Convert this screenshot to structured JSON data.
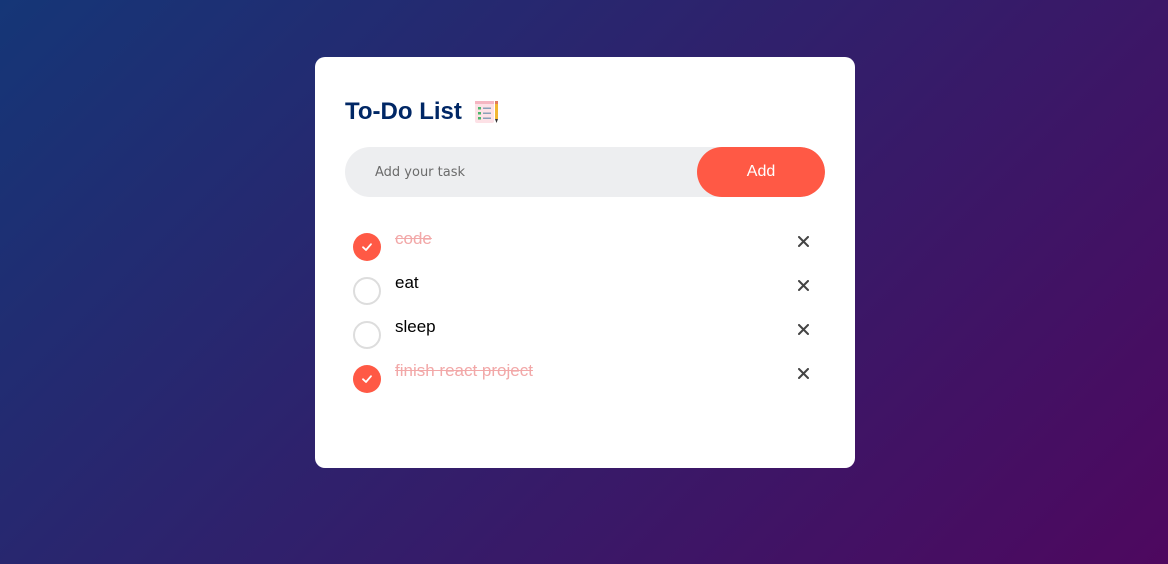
{
  "app": {
    "title": "To-Do List",
    "title_icon": "checklist-notepad-icon"
  },
  "input": {
    "placeholder": "Add your task",
    "value": ""
  },
  "add_button": {
    "label": "Add"
  },
  "tasks": [
    {
      "text": "code",
      "completed": true
    },
    {
      "text": "eat",
      "completed": false
    },
    {
      "text": "sleep",
      "completed": false
    },
    {
      "text": "finish react project",
      "completed": true
    }
  ],
  "colors": {
    "accent": "#ff5945",
    "title": "#002765",
    "background_start": "#153677",
    "background_end": "#4e085f",
    "completed_text": "#f2a8a8"
  }
}
